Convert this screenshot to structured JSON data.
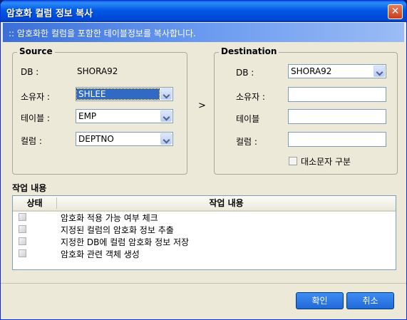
{
  "window": {
    "title": "암호화 컬럼 정보 복사",
    "close_icon": "close-icon"
  },
  "banner": {
    "text": ":: 암호화한 컬럼을 포함한 테이블정보를 복사합니다."
  },
  "source": {
    "title": "Source",
    "db_label": "DB :",
    "db_value": "SHORA92",
    "owner_label": "소유자 :",
    "owner_value": "SHLEE",
    "table_label": "테이블 :",
    "table_value": "EMP",
    "column_label": "컬럼 :",
    "column_value": "DEPTNO"
  },
  "arrow": ">",
  "destination": {
    "title": "Destination",
    "db_label": "DB :",
    "db_value": "SHORA92",
    "owner_label": "소유자 :",
    "owner_value": "",
    "table_label": "테이블",
    "table_value": "",
    "column_label": "컬럼 :",
    "column_value": "",
    "case_label": "대소문자 구분",
    "case_checked": false
  },
  "tasks": {
    "title": "작업 내용",
    "columns": [
      "상태",
      "작업 내용"
    ],
    "rows": [
      "암호화 적용 가능 여부 체크",
      "지정된 컬럼의 암호화 정보 추출",
      "지정한 DB에 컬럼 암호화 정보 저장",
      "암호화 관련 객체 생성"
    ]
  },
  "buttons": {
    "ok": "확인",
    "cancel": "취소"
  }
}
